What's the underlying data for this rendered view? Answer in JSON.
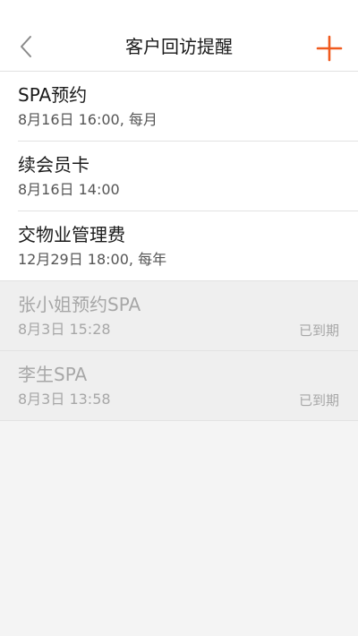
{
  "header": {
    "title": "客户回访提醒",
    "back_icon": "chevron-left-icon",
    "add_icon": "plus-icon",
    "accent_color": "#f05a1e"
  },
  "reminders": [
    {
      "title": "SPA预约",
      "time": "8月16日 16:00, 每月",
      "status": ""
    },
    {
      "title": "续会员卡",
      "time": "8月16日 14:00",
      "status": ""
    },
    {
      "title": "交物业管理费",
      "time": "12月29日 18:00, 每年",
      "status": ""
    },
    {
      "title": "张小姐预约SPA",
      "time": "8月3日 15:28",
      "status": "已到期"
    },
    {
      "title": "李生SPA",
      "time": "8月3日 13:58",
      "status": "已到期"
    }
  ]
}
